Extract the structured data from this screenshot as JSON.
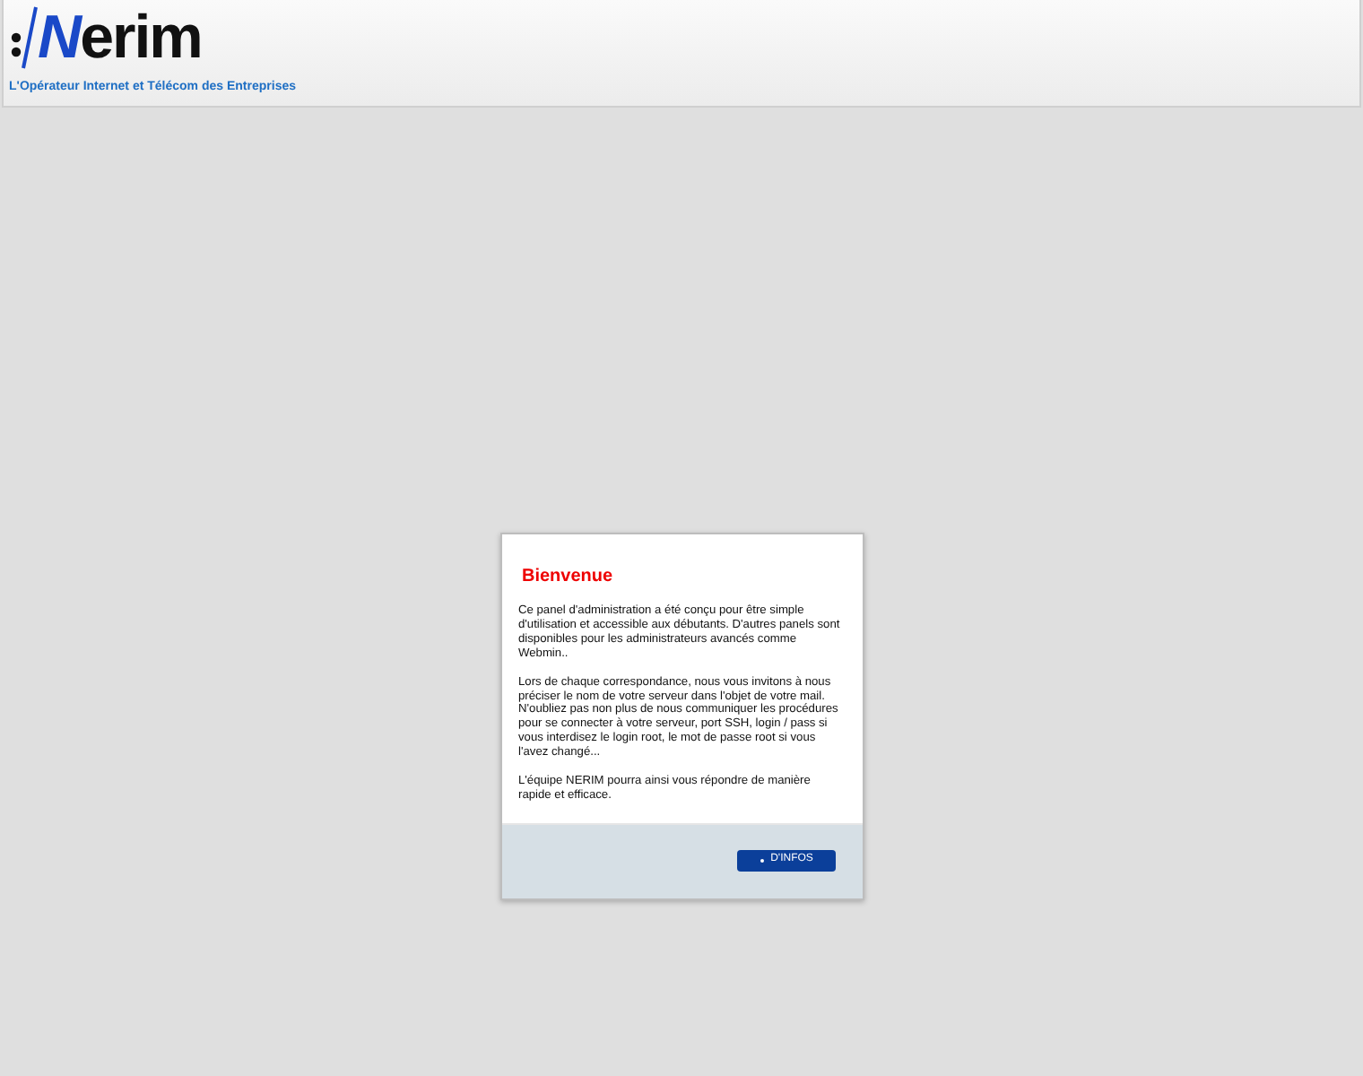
{
  "header": {
    "logo": "Nerim",
    "tagline": "L'Opérateur Internet et Télécom des Entreprises"
  },
  "dialog": {
    "title": "Bienvenue",
    "paragraphs": [
      "Ce panel d'administration a été conçu pour être simple d'utilisation et accessible aux débutants. D'autres panels sont disponibles pour les administrateurs avancés comme Webmin..",
      "Lors de chaque correspondance, nous vous invitons à nous préciser le nom de votre serveur dans l'objet de votre mail. N'oubliez pas non plus de nous communiquer les procédures pour se connecter à votre serveur, port SSH, login / pass si vous interdisez le login root, le mot de passe root si vous l'avez changé...",
      "L'équipe NERIM pourra ainsi vous répondre de manière rapide et efficace."
    ],
    "button": "D'INFOS"
  }
}
